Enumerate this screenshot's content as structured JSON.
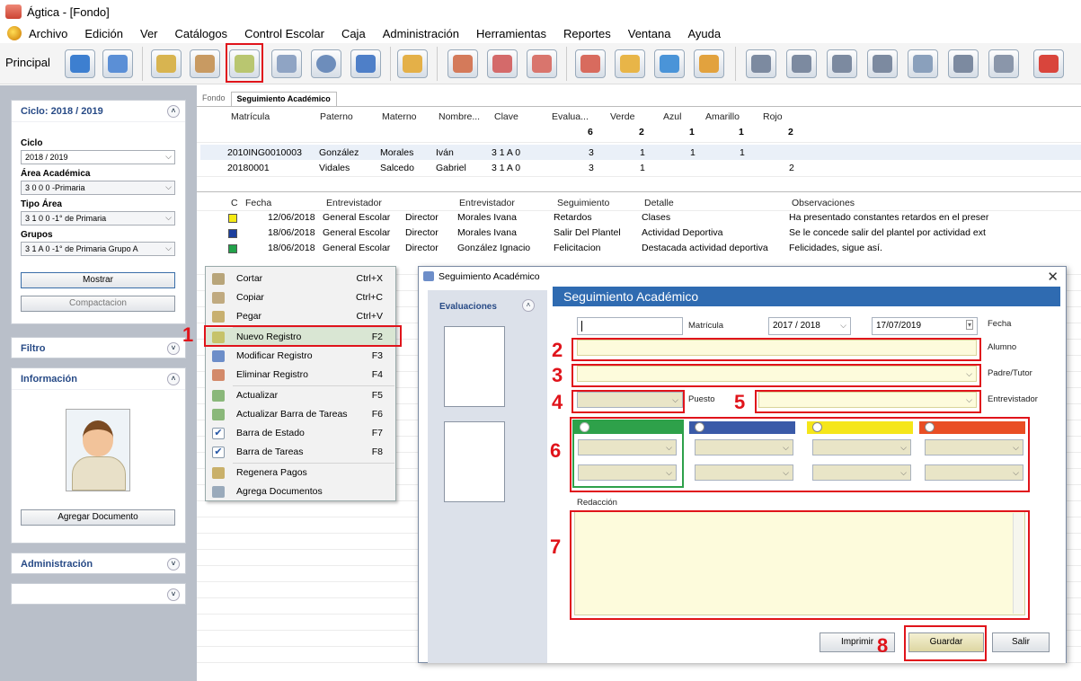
{
  "window": {
    "title": "Ágtica - [Fondo]"
  },
  "menu": [
    "Archivo",
    "Edición",
    "Ver",
    "Catálogos",
    "Control Escolar",
    "Caja",
    "Administración",
    "Herramientas",
    "Reportes",
    "Ventana",
    "Ayuda"
  ],
  "toolbar": {
    "label": "Principal"
  },
  "sidebar": {
    "ciclo_panel_title": "Ciclo: 2018 / 2019",
    "ciclo_label": "Ciclo",
    "ciclo_value": "2018 / 2019",
    "area_label": "Área Académica",
    "area_value": "3 0 0 0 -Primaria",
    "tipo_label": "Tipo Área",
    "tipo_value": "3 1 0 0 -1° de Primaria",
    "grupos_label": "Grupos",
    "grupos_value": "3 1 A 0 -1° de Primaria Grupo A",
    "mostrar": "Mostrar",
    "compactacion": "Compactacion",
    "filtro": "Filtro",
    "informacion": "Información",
    "agregar_documento": "Agregar Documento",
    "administracion": "Administración"
  },
  "tabs": [
    "Fondo",
    "Seguimiento Académico"
  ],
  "students": {
    "headers": [
      "Matrícula",
      "Paterno",
      "Materno",
      "Nombre...",
      "Clave",
      "Evalua...",
      "Verde",
      "Azul",
      "Amarillo",
      "Rojo"
    ],
    "totals": {
      "evalua": "6",
      "verde": "2",
      "azul": "1",
      "amarillo": "1",
      "rojo": "2"
    },
    "rows": [
      {
        "matricula": "2010ING0010003",
        "paterno": "González",
        "materno": "Morales",
        "nombre": "Iván",
        "clave": "3 1 A 0",
        "evalua": "3",
        "verde": "1",
        "azul": "1",
        "amarillo": "1",
        "rojo": ""
      },
      {
        "matricula": "20180001",
        "paterno": "Vidales",
        "materno": "Salcedo",
        "nombre": "Gabriel",
        "clave": "3 1 A 0",
        "evalua": "3",
        "verde": "1",
        "azul": "",
        "amarillo": "",
        "rojo": "2"
      }
    ]
  },
  "followups": {
    "headers": [
      "C",
      "Fecha",
      "Entrevistador",
      "Entrevistador",
      "Seguimiento",
      "Detalle",
      "Observaciones"
    ],
    "rows": [
      {
        "color": "#f5ea14",
        "fecha": "12/06/2018",
        "entrevistador": "General Escolar",
        "puesto": "Director",
        "alumno": "Morales  Ivana",
        "seguimiento": "Retardos",
        "detalle": "Clases",
        "observaciones": "Ha presentado constantes retardos en el preser"
      },
      {
        "color": "#1c3f9e",
        "fecha": "18/06/2018",
        "entrevistador": "General Escolar",
        "puesto": "Director",
        "alumno": "Morales  Ivana",
        "seguimiento": "Salir Del Plantel",
        "detalle": "Actividad Deportiva",
        "observaciones": "Se le concede salir del plantel por actividad ext"
      },
      {
        "color": "#22a24a",
        "fecha": "18/06/2018",
        "entrevistador": "General Escolar",
        "puesto": "Director",
        "alumno": "González  Ignacio",
        "seguimiento": "Felicitacion",
        "detalle": "Destacada actividad deportiva",
        "observaciones": "Felicidades, sigue así."
      }
    ]
  },
  "context_menu": [
    {
      "label": "Cortar",
      "shortcut": "Ctrl+X"
    },
    {
      "label": "Copiar",
      "shortcut": "Ctrl+C"
    },
    {
      "label": "Pegar",
      "shortcut": "Ctrl+V"
    },
    {
      "label": "Nuevo Registro",
      "shortcut": "F2"
    },
    {
      "label": "Modificar Registro",
      "shortcut": "F3"
    },
    {
      "label": "Eliminar Registro",
      "shortcut": "F4"
    },
    {
      "label": "Actualizar",
      "shortcut": "F5"
    },
    {
      "label": "Actualizar Barra de Tareas",
      "shortcut": "F6"
    },
    {
      "label": "Barra de Estado",
      "shortcut": "F7"
    },
    {
      "label": "Barra de Tareas",
      "shortcut": "F8"
    },
    {
      "label": "Regenera Pagos",
      "shortcut": ""
    },
    {
      "label": "Agrega Documentos",
      "shortcut": ""
    }
  ],
  "dialog": {
    "title": "Seguimiento Académico",
    "banner": "Seguimiento Académico",
    "evaluaciones": "Evaluaciones",
    "matricula_label": "Matrícula",
    "ciclo_value": "2017 / 2018",
    "fecha_value": "17/07/2019",
    "fecha_label": "Fecha",
    "alumno_label": "Alumno",
    "padre_label": "Padre/Tutor",
    "puesto_label": "Puesto",
    "entrevistador_label": "Entrevistador",
    "redaccion_label": "Redacción",
    "imprimir": "Imprimir",
    "guardar": "Guardar",
    "salir": "Salir"
  },
  "annotations": [
    "1",
    "2",
    "3",
    "4",
    "5",
    "6",
    "7",
    "8"
  ],
  "colors": {
    "green": "#2ea14a",
    "blue": "#3a5aa8",
    "yellow": "#f5e61a",
    "red": "#e94e24",
    "highlight": "#e0141b"
  }
}
